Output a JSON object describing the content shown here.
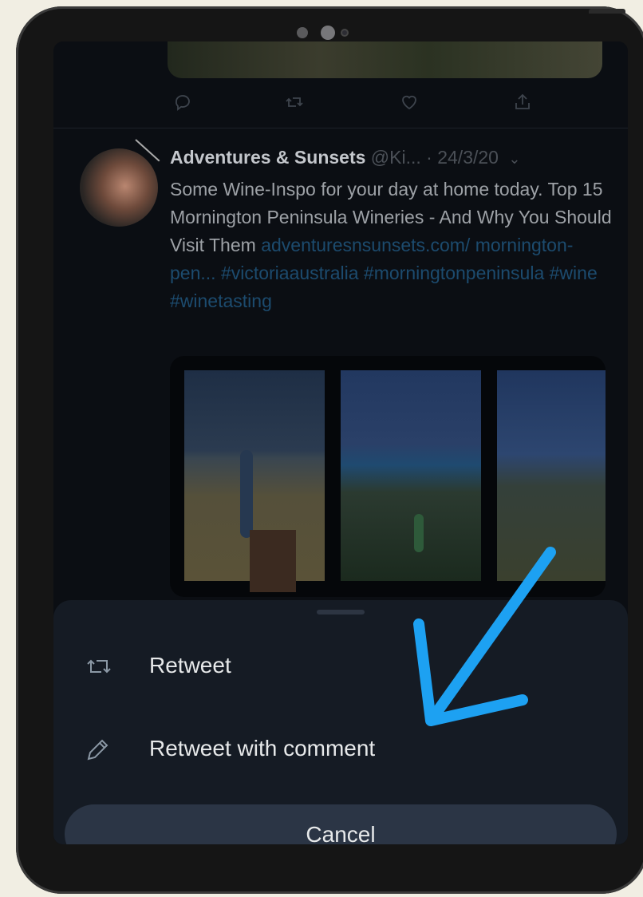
{
  "tweet": {
    "author": "Adventures & Sunsets",
    "handle": "@Ki...",
    "date": "· 24/3/20",
    "text": "Some Wine-Inspo for your day at home today. Top 15 Mornington Peninsula Wineries - And Why You Should Visit Them",
    "link_1": "adventuresnsunsets.com/",
    "link_2": "mornington-pen...",
    "hashtag_1": "#victoriaaustralia",
    "hashtag_2": "#morningtonpeninsula",
    "hashtag_3": "#wine",
    "hashtag_4": "#winetasting"
  },
  "action_sheet": {
    "items": [
      {
        "label": "Retweet",
        "icon": "retweet-icon"
      },
      {
        "label": "Retweet with comment",
        "icon": "pencil-icon"
      }
    ],
    "cancel_label": "Cancel"
  },
  "tweet_actions": [
    "reply-icon",
    "retweet-icon",
    "like-icon",
    "share-icon"
  ],
  "colors": {
    "sheet_bg": "#151b24",
    "cancel_bg": "#2b3545",
    "link": "#1c4b6e",
    "annotation_arrow": "#1da1f2"
  }
}
